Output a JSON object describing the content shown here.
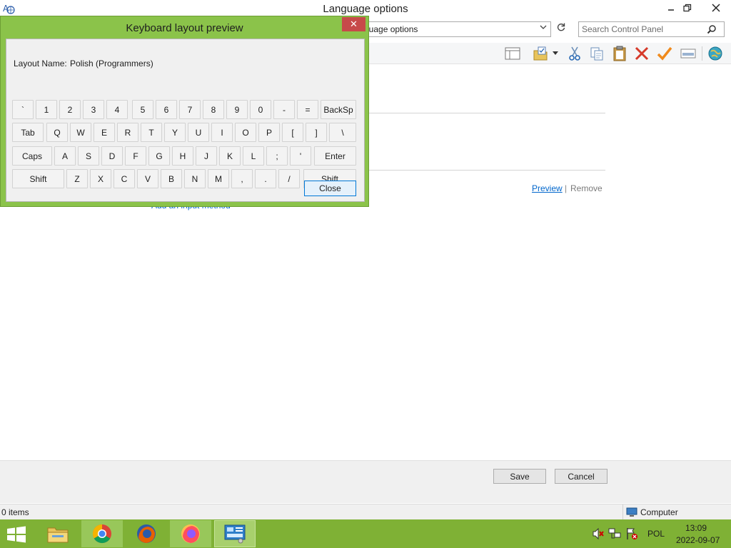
{
  "window": {
    "title": "Language options",
    "address": "guage options",
    "search_placeholder": "Search Control Panel"
  },
  "content": {
    "preview_link": "Preview",
    "link_separator": "|",
    "remove_link": "Remove",
    "add_input_method": "Add an input method"
  },
  "footer": {
    "save_label": "Save",
    "cancel_label": "Cancel"
  },
  "statusbar": {
    "item_count": "0 items",
    "location": "Computer"
  },
  "dialog": {
    "title": "Keyboard layout preview",
    "close_x": "✕",
    "layout_name_label": "Layout Name:",
    "layout_name_value": "Polish (Programmers)",
    "close_label": "Close",
    "rows": [
      [
        "`",
        "1",
        "2",
        "3",
        "4",
        "5",
        "6",
        "7",
        "8",
        "9",
        "0",
        "-",
        "=",
        "BackSp"
      ],
      [
        "Tab",
        "Q",
        "W",
        "E",
        "R",
        "T",
        "Y",
        "U",
        "I",
        "O",
        "P",
        "[",
        "]",
        "\\"
      ],
      [
        "Caps",
        "A",
        "S",
        "D",
        "F",
        "G",
        "H",
        "J",
        "K",
        "L",
        ";",
        "'",
        "Enter"
      ],
      [
        "Shift",
        "Z",
        "X",
        "C",
        "V",
        "B",
        "N",
        "M",
        ",",
        ".",
        "/",
        "Shift"
      ]
    ]
  },
  "taskbar": {
    "language": "POL",
    "time": "13:09",
    "date": "2022-09-07"
  },
  "colors": {
    "dialog_frame": "#8bc34a",
    "taskbar": "#7fb135",
    "link": "#0066cc"
  }
}
